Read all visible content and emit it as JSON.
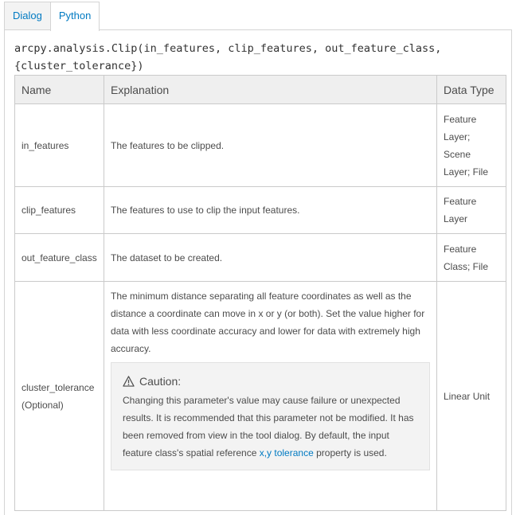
{
  "tabs": [
    {
      "label": "Dialog"
    },
    {
      "label": "Python"
    }
  ],
  "signature": "arcpy.analysis.Clip(in_features, clip_features, out_feature_class, {cluster_tolerance})",
  "table": {
    "headers": [
      "Name",
      "Explanation",
      "Data Type"
    ],
    "rows": [
      {
        "name": "in_features",
        "explanation": "The features to be clipped.",
        "data_type": "Feature Layer; Scene Layer; File"
      },
      {
        "name": "clip_features",
        "explanation": "The features to use to clip the input features.",
        "data_type": "Feature Layer"
      },
      {
        "name": "out_feature_class",
        "explanation": "The dataset to be created.",
        "data_type": "Feature Class; File"
      },
      {
        "name": "cluster_tolerance",
        "name_note": "(Optional)",
        "explanation": "The minimum distance separating all feature coordinates as well as the distance a coordinate can move in x or y (or both). Set the value higher for data with less coordinate accuracy and lower for data with extremely high accuracy.",
        "data_type": "Linear Unit"
      }
    ]
  },
  "caution": {
    "icon": "warning-icon",
    "title": "Caution:",
    "text_before_link": "Changing this parameter's value may cause failure or unexpected results. It is recommended that this parameter not be modified. It has been removed from view in the tool dialog. By default, the input feature class's spatial reference ",
    "link": "x,y tolerance",
    "text_after_link": " property is used."
  }
}
